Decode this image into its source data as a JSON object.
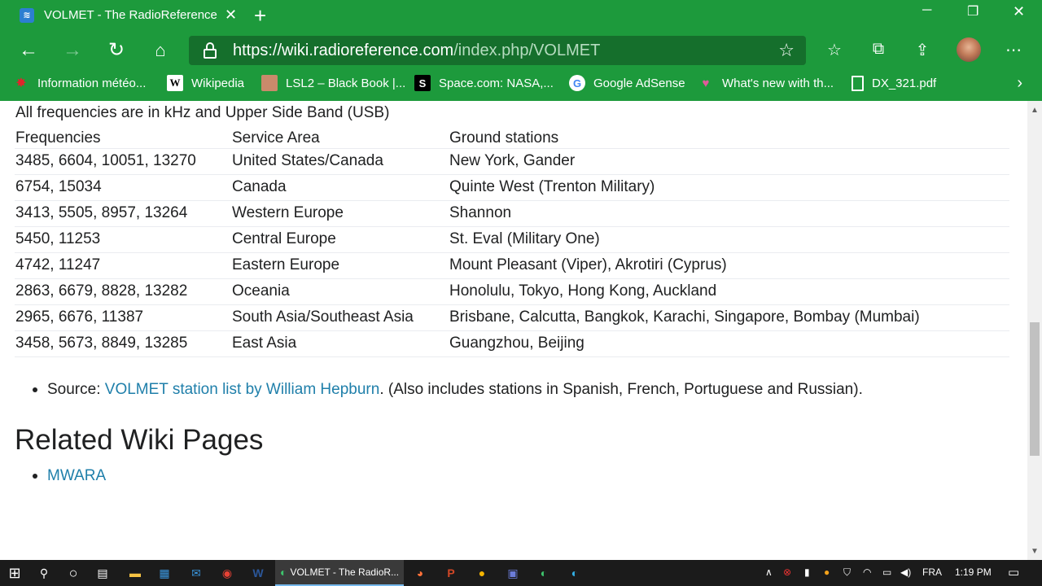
{
  "browser": {
    "tab_title": "VOLMET - The RadioReference W",
    "url_host": "https://wiki.radioreference.com",
    "url_path": "/index.php/VOLMET",
    "bookmarks": [
      {
        "label": "Information météo...",
        "icon": "maple-leaf-icon"
      },
      {
        "label": "Wikipedia",
        "icon": "wikipedia-icon"
      },
      {
        "label": "LSL2 – Black Book |...",
        "icon": "lsl2-icon"
      },
      {
        "label": "Space.com: NASA,...",
        "icon": "space-icon"
      },
      {
        "label": "Google AdSense",
        "icon": "google-icon"
      },
      {
        "label": "What's new with th...",
        "icon": "bookmark-icon"
      },
      {
        "label": "DX_321.pdf",
        "icon": "file-icon"
      }
    ]
  },
  "page": {
    "intro": "All frequencies are in kHz and Upper Side Band (USB)",
    "table": {
      "headers": [
        "Frequencies",
        "Service Area",
        "Ground stations"
      ],
      "rows": [
        [
          "3485, 6604, 10051, 13270",
          "United States/Canada",
          "New York, Gander"
        ],
        [
          "6754, 15034",
          "Canada",
          "Quinte West (Trenton Military)"
        ],
        [
          "3413, 5505, 8957, 13264",
          "Western Europe",
          "Shannon"
        ],
        [
          "5450, 11253",
          "Central Europe",
          "St. Eval (Military One)"
        ],
        [
          "4742, 11247",
          "Eastern Europe",
          "Mount Pleasant (Viper), Akrotiri (Cyprus)"
        ],
        [
          "2863, 6679, 8828, 13282",
          "Oceania",
          "Honolulu, Tokyo, Hong Kong, Auckland"
        ],
        [
          "2965, 6676, 11387",
          "South Asia/Southeast Asia",
          "Brisbane, Calcutta, Bangkok, Karachi, Singapore, Bombay (Mumbai)"
        ],
        [
          "3458, 5673, 8849, 13285",
          "East Asia",
          "Guangzhou, Beijing"
        ]
      ]
    },
    "source_prefix": "Source: ",
    "source_link": "VOLMET station list by William Hepburn",
    "source_suffix": ". (Also includes stations in Spanish, French, Portuguese and Russian).",
    "related_heading": "Related Wiki Pages",
    "related_link": "MWARA"
  },
  "taskbar": {
    "active_app": "VOLMET - The RadioR...",
    "language": "FRA",
    "time": "1:19 PM"
  },
  "colors": {
    "browser_green": "#1d9a3c",
    "link": "#1f7faa"
  }
}
